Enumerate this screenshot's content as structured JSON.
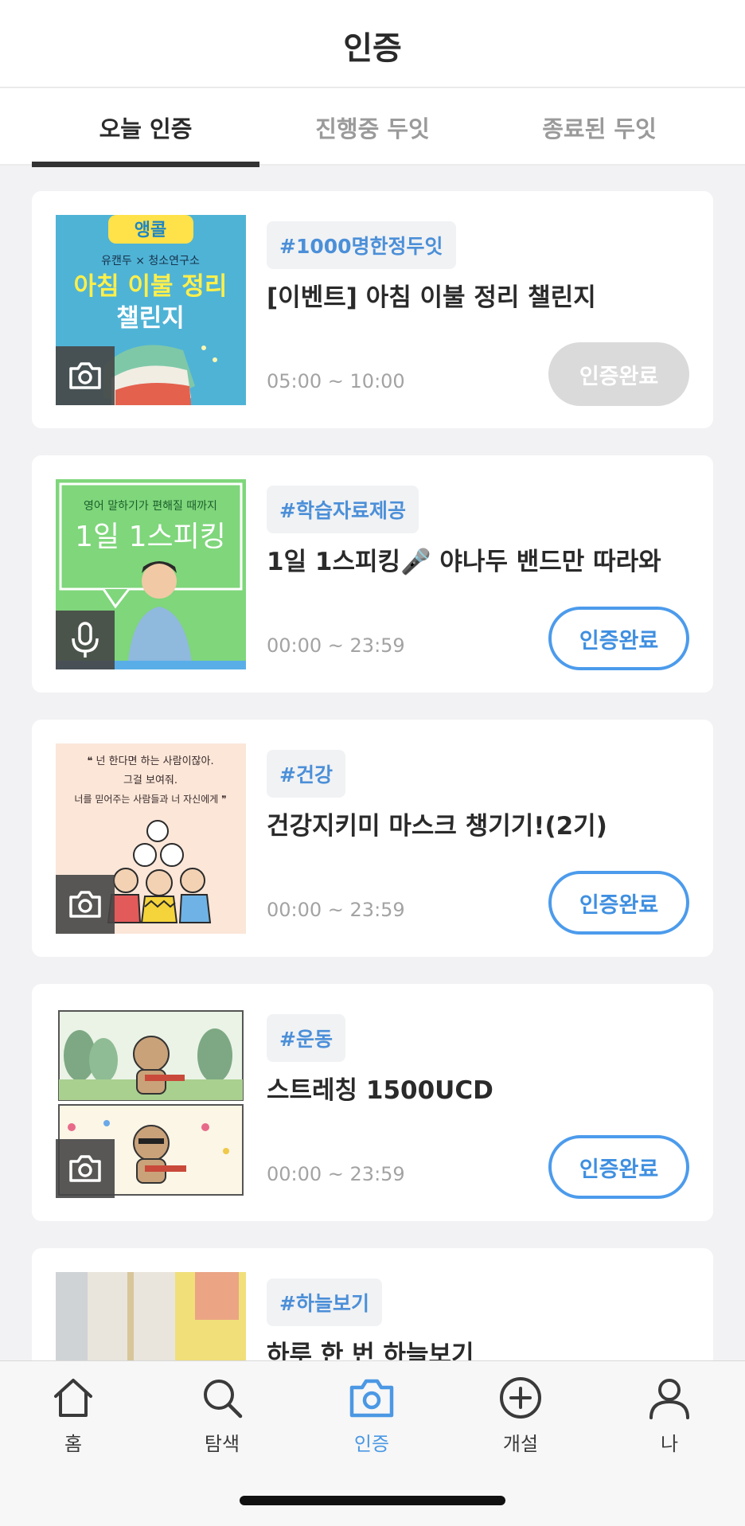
{
  "header": {
    "title": "인증"
  },
  "tabs": [
    {
      "label": "오늘 인증",
      "active": true
    },
    {
      "label": "진행중 두잇",
      "active": false
    },
    {
      "label": "종료된 두잇",
      "active": false
    }
  ],
  "cards": [
    {
      "tag": "#1000명한정두잇",
      "title": "[이벤트] 아침 이불 정리 챌린지",
      "time": "05:00 ~ 10:00",
      "button": "인증완료",
      "button_state": "done",
      "badge_icon": "camera-icon",
      "thumb": {
        "badge_top": "앵콜",
        "small": "유캔두 × 청소연구소",
        "line1": "아침 이불 정리",
        "line2": "챌린지"
      }
    },
    {
      "tag": "#학습자료제공",
      "title": "1일 1스피킹🎤 야나두 밴드만 따라와",
      "time": "00:00 ~ 23:59",
      "button": "인증완료",
      "button_state": "open",
      "badge_icon": "microphone-icon",
      "thumb": {
        "small": "영어 말하기가 편해질 때까지",
        "line1": "1일 1스피킹"
      }
    },
    {
      "tag": "#건강",
      "title": "건강지키미 마스크 챙기기!(2기)",
      "time": "00:00 ~ 23:59",
      "button": "인증완료",
      "button_state": "open",
      "badge_icon": "camera-icon",
      "thumb": {
        "line1": "❝ 넌 한다면 하는 사람이잖아.",
        "line2": "그걸 보여줘.",
        "line3": "너를 믿어주는 사람들과 너 자신에게 ❞"
      }
    },
    {
      "tag": "#운동",
      "title": "스트레칭 1500UCD",
      "time": "00:00 ~ 23:59",
      "button": "인증완료",
      "button_state": "open",
      "badge_icon": "camera-icon",
      "thumb": {}
    },
    {
      "tag": "#하늘보기",
      "title": "하루 한 번 하늘보기",
      "time": "",
      "button": "",
      "button_state": "",
      "badge_icon": "",
      "thumb": {}
    }
  ],
  "nav": [
    {
      "label": "홈",
      "icon": "home-icon",
      "active": false
    },
    {
      "label": "탐색",
      "icon": "search-icon",
      "active": false
    },
    {
      "label": "인증",
      "icon": "camera-icon",
      "active": true
    },
    {
      "label": "개설",
      "icon": "plus-circle-icon",
      "active": false
    },
    {
      "label": "나",
      "icon": "person-icon",
      "active": false
    }
  ],
  "colors": {
    "accent_blue": "#4c9bec",
    "tag_text": "#4b8fd8",
    "done_button": "#dadada",
    "background": "#f2f2f4"
  }
}
